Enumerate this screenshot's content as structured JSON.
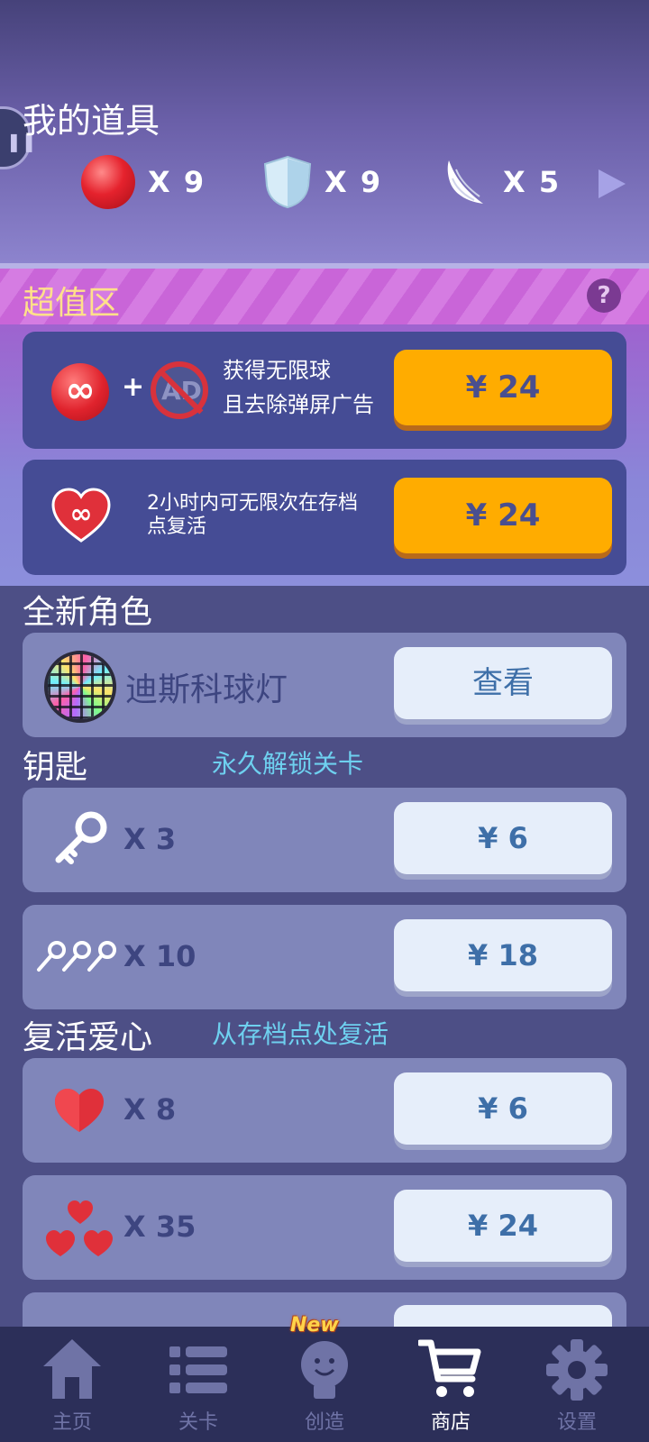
{
  "inventory": {
    "title": "我的道具",
    "side_tab_glyph": "❚❚",
    "items": [
      {
        "icon": "red-ball-icon",
        "count": "X 9"
      },
      {
        "icon": "shield-icon",
        "count": "X 9"
      },
      {
        "icon": "wing-icon",
        "count": "X 5"
      }
    ]
  },
  "super_value": {
    "title": "超值区",
    "help": "?",
    "offers": [
      {
        "symbol": "∞",
        "plus": "+",
        "ad": "AD",
        "line1": "获得无限球",
        "line2": "且去除弹屏广告",
        "price": "¥ 24"
      },
      {
        "symbol": "∞",
        "text": "2小时内可无限次在存档点复活",
        "price": "¥ 24"
      }
    ]
  },
  "new_character": {
    "title": "全新角色",
    "name": "迪斯科球灯",
    "button": "查看"
  },
  "keys": {
    "title": "钥匙",
    "subtitle": "永久解锁关卡",
    "items": [
      {
        "qty": "X 3",
        "price": "¥ 6"
      },
      {
        "qty": "X 10",
        "price": "¥ 18"
      }
    ]
  },
  "revive_hearts": {
    "title": "复活爱心",
    "subtitle": "从存档点处复活",
    "items": [
      {
        "qty": "X 8",
        "price": "¥ 6"
      },
      {
        "qty": "X 35",
        "price": "¥ 24"
      }
    ]
  },
  "nav": {
    "new_badge": "New",
    "items": [
      {
        "label": "主页",
        "icon": "home-icon"
      },
      {
        "label": "关卡",
        "icon": "list-icon"
      },
      {
        "label": "创造",
        "icon": "lightbulb-icon"
      },
      {
        "label": "商店",
        "icon": "cart-icon",
        "active": true
      },
      {
        "label": "设置",
        "icon": "gear-icon"
      }
    ]
  },
  "colors": {
    "gold_button": "#ffac00",
    "light_button": "#e6eefa",
    "accent_cyan": "#6ed0ef",
    "section_yellow": "#ffe08a"
  }
}
